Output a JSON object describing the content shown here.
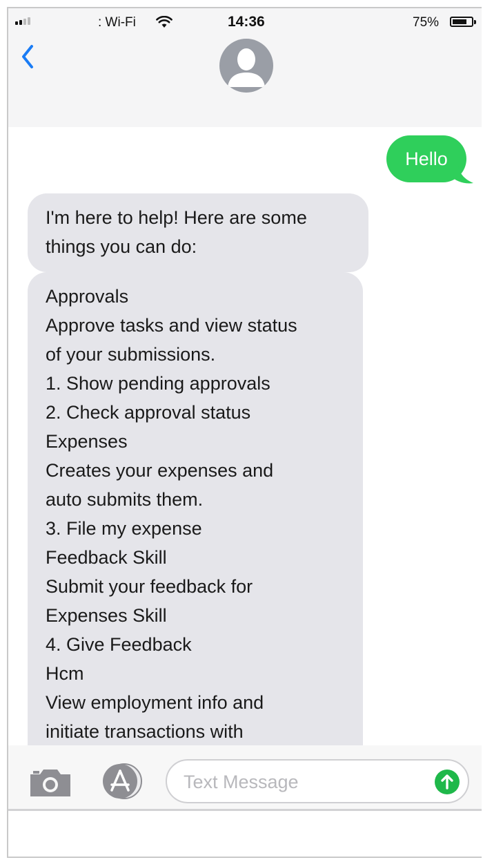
{
  "status_bar": {
    "carrier": ": Wi-Fi",
    "time": "14:36",
    "battery_percent": "75%",
    "battery_level": 0.75,
    "wifi_icon": "wifi-icon",
    "signal_icon": "signal-bars-icon"
  },
  "nav": {
    "back_icon": "chevron-left-icon",
    "avatar_icon": "person-silhouette-icon"
  },
  "messages": {
    "outgoing": [
      {
        "text": "Hello"
      }
    ],
    "incoming": [
      {
        "lines": [
          "I'm here to help! Here are some",
          "things you can do:"
        ]
      },
      {
        "lines": [
          "Approvals",
          "Approve tasks and view status",
          "of your submissions.",
          "1. Show pending approvals",
          "2. Check approval status",
          "Expenses",
          "Creates your expenses and",
          "auto submits them.",
          "3. File my expense",
          "Feedback Skill",
          "Submit your feedback for",
          "Expenses Skill",
          "4. Give Feedback",
          "Hcm",
          "View employment info and",
          "initiate transactions with"
        ]
      }
    ]
  },
  "input_bar": {
    "camera_icon": "camera-icon",
    "apps_icon": "app-store-icon",
    "placeholder": "Text Message",
    "value": "",
    "send_icon": "send-arrow-up-icon"
  },
  "colors": {
    "outgoing_bubble": "#2fcf5b",
    "incoming_bubble": "#e5e5ea",
    "accent_blue": "#1a7cf5",
    "send_button": "#1fb84a"
  }
}
